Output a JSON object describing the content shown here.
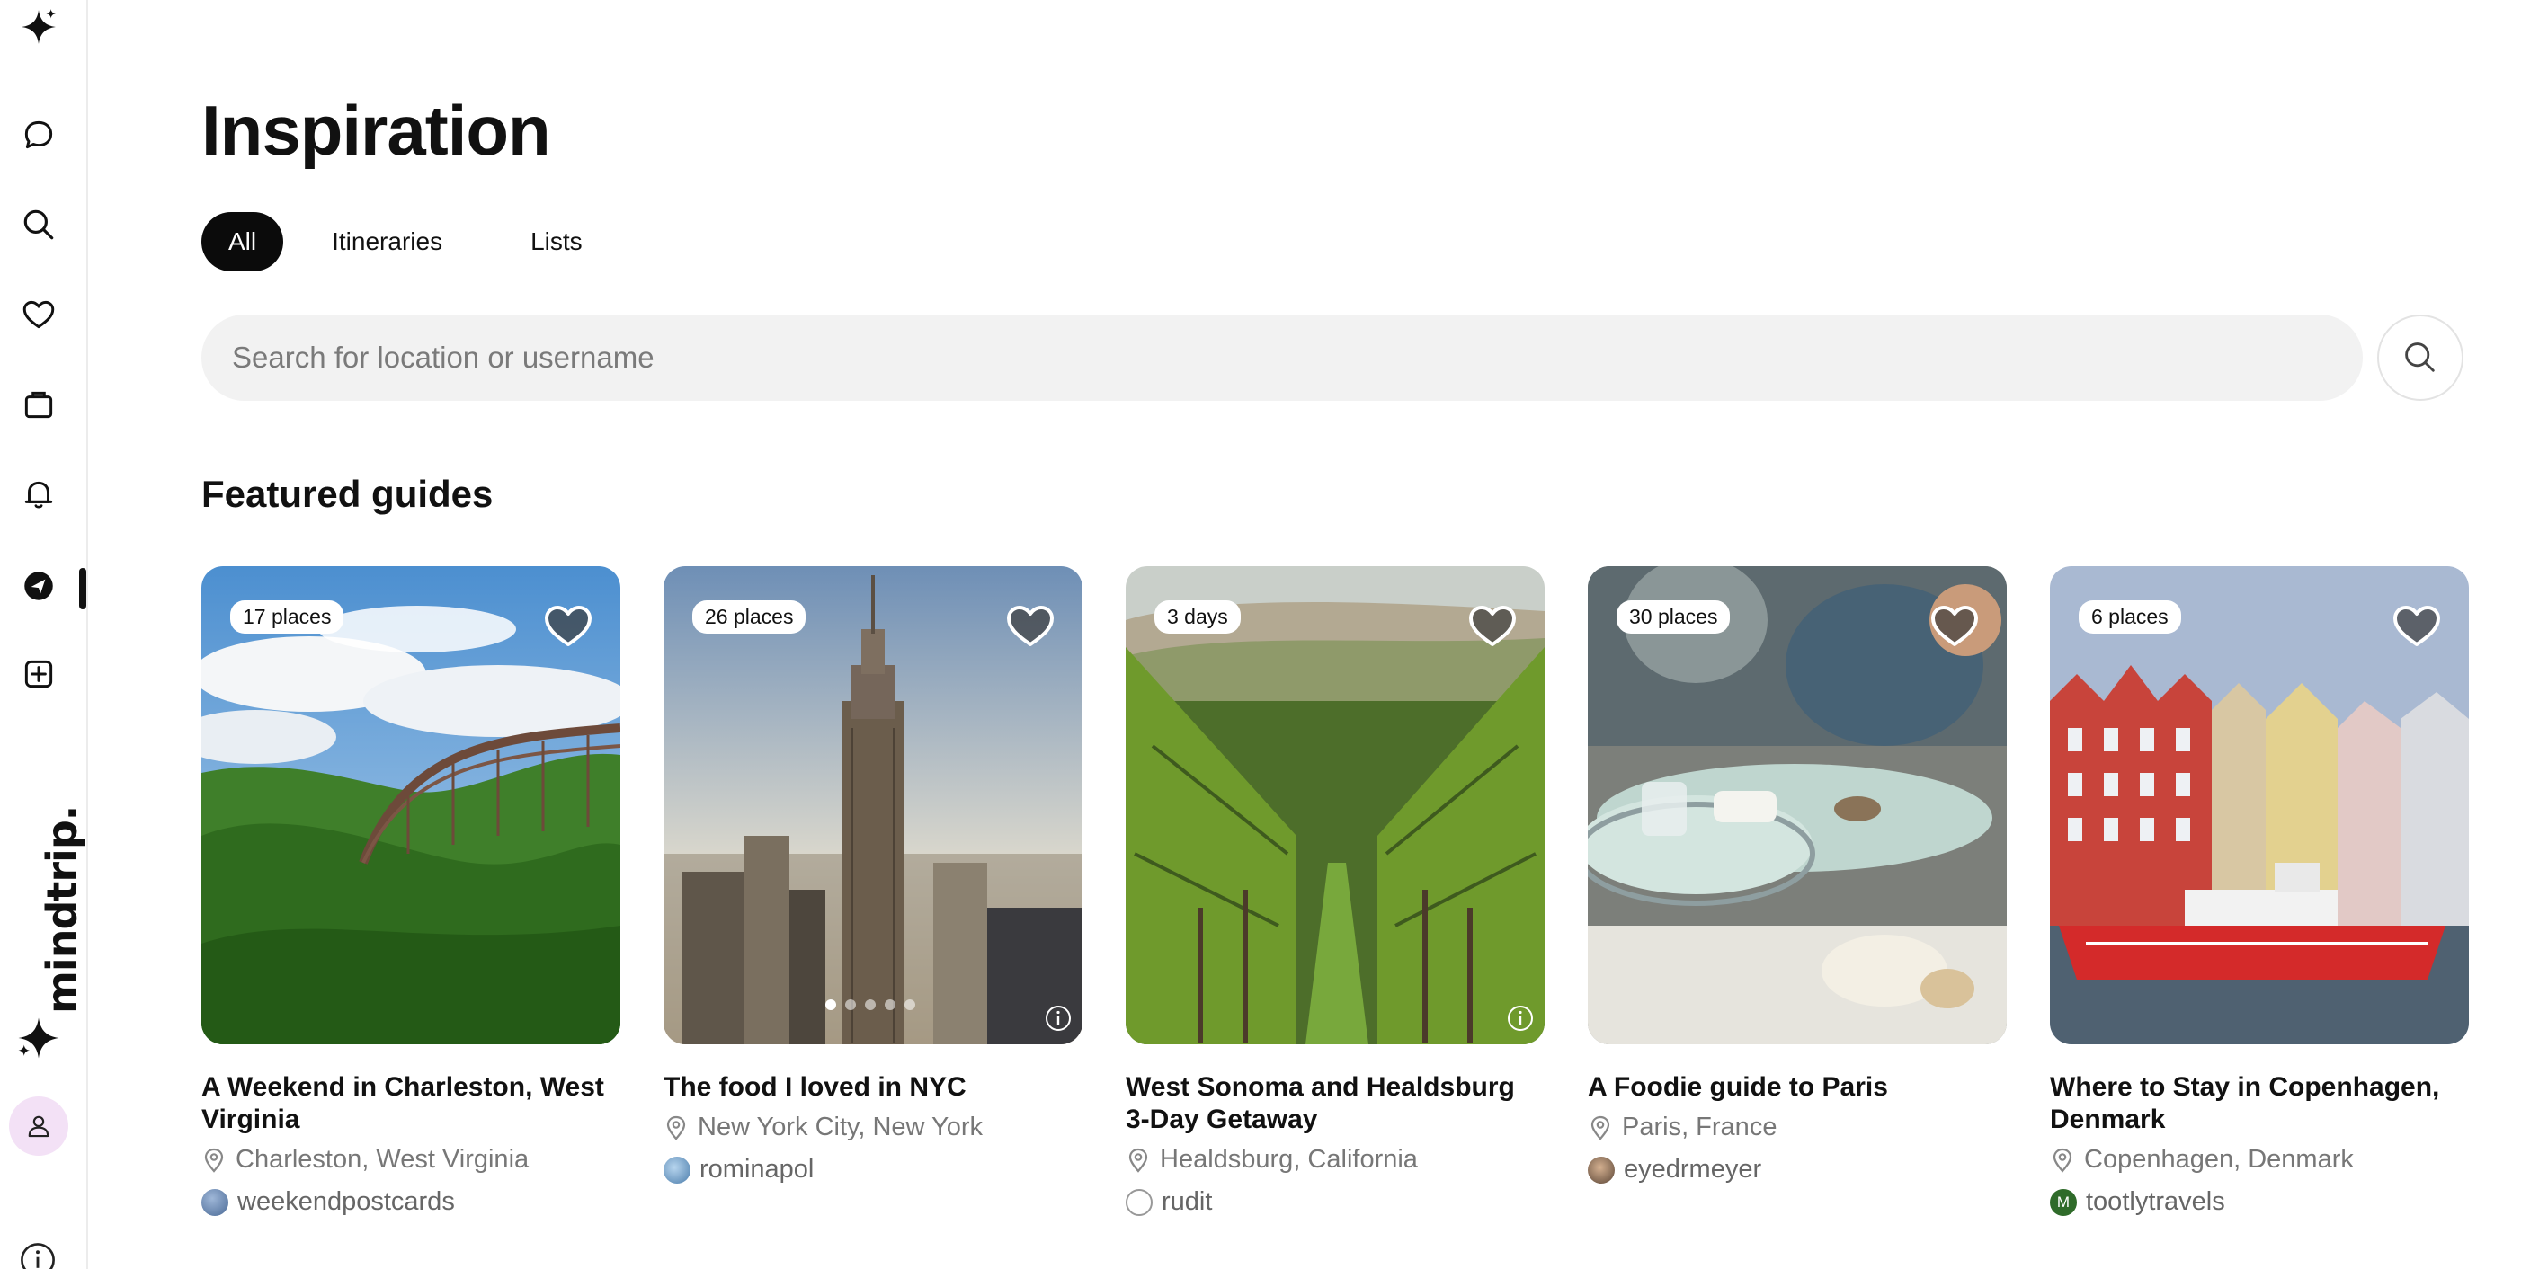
{
  "sidebar": {
    "items": [
      {
        "icon": "sparkle-logo-icon"
      },
      {
        "icon": "chat-bubble-icon"
      },
      {
        "icon": "search-icon"
      },
      {
        "icon": "heart-icon"
      },
      {
        "icon": "briefcase-icon"
      },
      {
        "icon": "bell-icon"
      },
      {
        "icon": "compass-icon",
        "active": true
      },
      {
        "icon": "add-square-icon"
      }
    ],
    "brand": "mindtrip.",
    "profile_icon": "user-icon",
    "info_icon": "info-icon",
    "avatar_bg": "#f3e1f6"
  },
  "page": {
    "title": "Inspiration"
  },
  "tabs": [
    {
      "label": "All",
      "active": true
    },
    {
      "label": "Itineraries",
      "active": false
    },
    {
      "label": "Lists",
      "active": false
    }
  ],
  "search": {
    "placeholder": "Search for location or username",
    "value": ""
  },
  "featured": {
    "title": "Featured guides",
    "cards": [
      {
        "badge": "17 places",
        "title": "A Weekend in Charleston, West Virginia",
        "location": "Charleston, West Virginia",
        "user": "weekendpostcards",
        "image": "bridge-forest"
      },
      {
        "badge": "26 places",
        "title": "The food I loved in NYC",
        "location": "New York City, New York",
        "user": "rominapol",
        "image": "nyc-skyline"
      },
      {
        "badge": "3 days",
        "title": "West Sonoma and Healdsburg 3-Day Getaway",
        "location": "Healdsburg, California",
        "user": "rudit",
        "image": "vineyard"
      },
      {
        "badge": "30 places",
        "title": "A Foodie guide to Paris",
        "location": "Paris, France",
        "user": "eyedrmeyer",
        "image": "paris-cafe"
      },
      {
        "badge": "6 places",
        "title": "Where to Stay in Copenhagen, Denmark",
        "location": "Copenhagen, Denmark",
        "user": "tootlytravels",
        "user_initial": "M",
        "image": "copenhagen-harbor"
      }
    ]
  },
  "colors": {
    "accent": "#0b0b0b",
    "search_bg": "#f2f2f2",
    "muted_text": "#777777"
  }
}
